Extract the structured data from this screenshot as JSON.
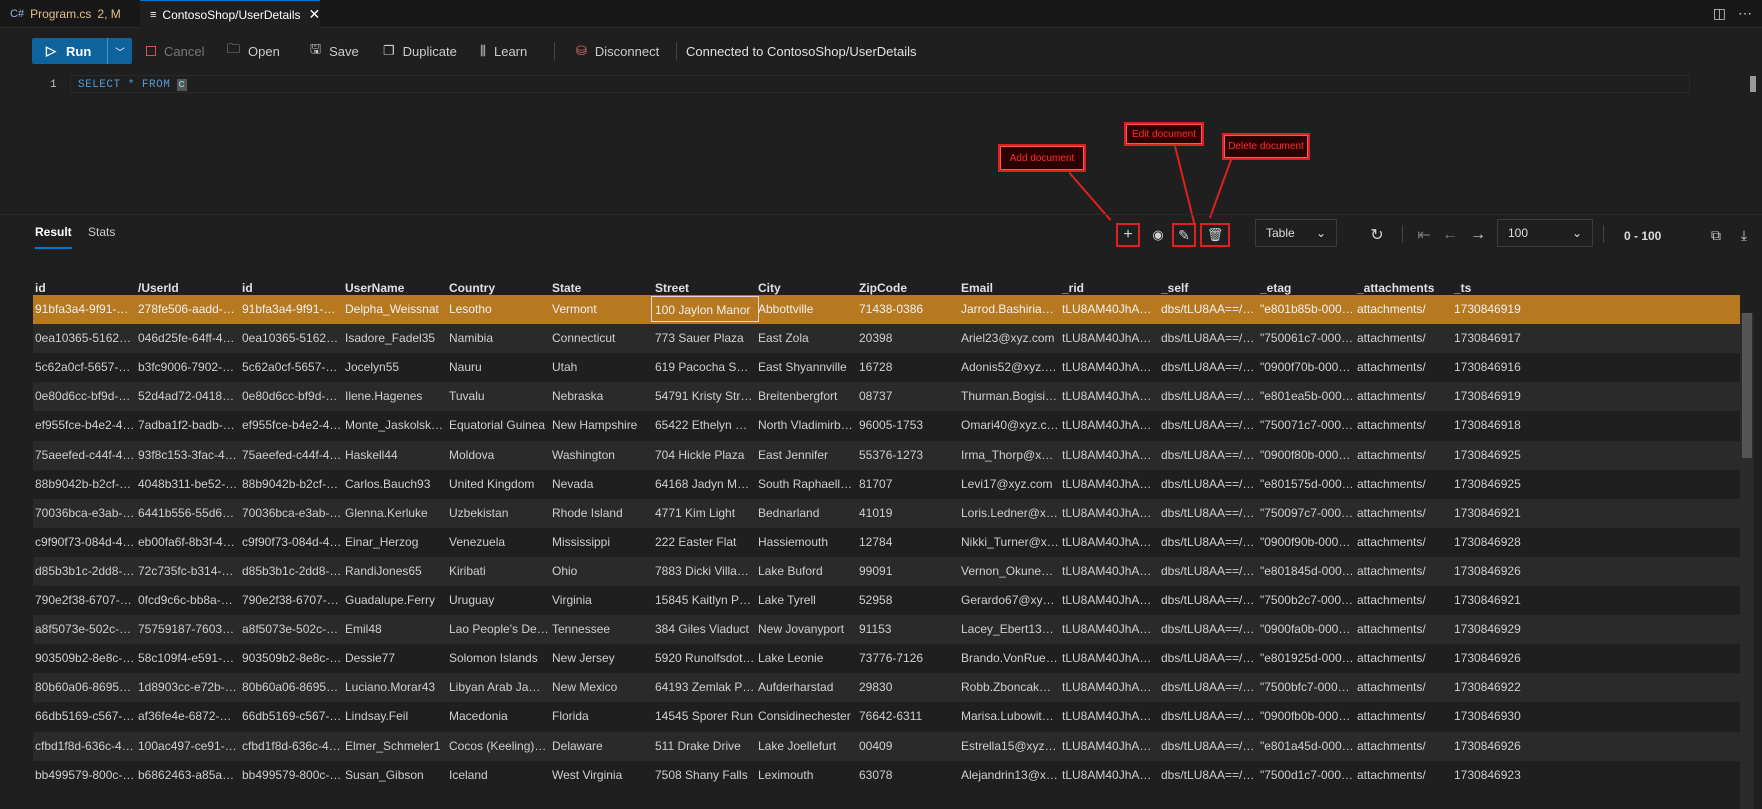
{
  "tabs": [
    {
      "icon": "csharp-icon",
      "label": "Program.cs",
      "badge": "2, M"
    },
    {
      "icon": "query-icon",
      "label": "ContosoShop/UserDetails",
      "close": "✕"
    }
  ],
  "toolbar": {
    "run": "Run",
    "cancel": "Cancel",
    "open": "Open",
    "save": "Save",
    "duplicate": "Duplicate",
    "learn": "Learn",
    "disconnect": "Disconnect",
    "status": "Connected to ContosoShop/UserDetails"
  },
  "editor": {
    "line_number": "1",
    "query_prefix": "SELECT * FROM ",
    "query_cursor": "c"
  },
  "annotations": {
    "add": "Add document",
    "edit": "Edit document",
    "delete": "Delete document"
  },
  "results": {
    "tab_result": "Result",
    "tab_stats": "Stats",
    "view_mode": "Table",
    "page_size": "100",
    "range": "0 - 100"
  },
  "colors": {
    "accent": "#0e639c",
    "selected_row": "#b7791f",
    "annotation": "#e02020"
  },
  "columns": [
    "id",
    "/UserId",
    "id",
    "UserName",
    "Country",
    "State",
    "Street",
    "City",
    "ZipCode",
    "Email",
    "_rid",
    "_self",
    "_etag",
    "_attachments",
    "_ts"
  ],
  "rows": [
    [
      "91bfa3a4-9f91-46...",
      "278fe506-aadd-45...",
      "91bfa3a4-9f91-46...",
      "Delpha_Weissnat",
      "Lesotho",
      "Vermont",
      "100 Jaylon Manor",
      "Abbottville",
      "71438-0386",
      "Jarrod.Bashirian91...",
      "tLU8AM40JhABA...",
      "dbs/tLU8AA==/c...",
      "\"e801b85b-0000-...",
      "attachments/",
      "1730846919"
    ],
    [
      "0ea10365-5162-43...",
      "046d25fe-64ff-48c...",
      "0ea10365-5162-43...",
      "Isadore_Fadel35",
      "Namibia",
      "Connecticut",
      "773 Sauer Plaza",
      "East Zola",
      "20398",
      "Ariel23@xyz.com",
      "tLU8AM40JhABA...",
      "dbs/tLU8AA==/c...",
      "\"750061c7-0000-...",
      "attachments/",
      "1730846917"
    ],
    [
      "5c62a0cf-5657-4b...",
      "b3fc9006-7902-4b...",
      "5c62a0cf-5657-4b...",
      "Jocelyn55",
      "Nauru",
      "Utah",
      "619 Pacocha Sprin...",
      "East Shyannville",
      "16728",
      "Adonis52@xyz.com",
      "tLU8AM40JhABA...",
      "dbs/tLU8AA==/c...",
      "\"0900f70b-0000-...",
      "attachments/",
      "1730846916"
    ],
    [
      "0e80d6cc-bf9d-49...",
      "52d4ad72-0418-4f...",
      "0e80d6cc-bf9d-49...",
      "Ilene.Hagenes",
      "Tuvalu",
      "Nebraska",
      "54791 Kristy Street",
      "Breitenbergfort",
      "08737",
      "Thurman.Bogisich...",
      "tLU8AM40JhACA...",
      "dbs/tLU8AA==/c...",
      "\"e801ea5b-0000-...",
      "attachments/",
      "1730846919"
    ],
    [
      "ef955fce-b4e2-44e...",
      "7adba1f2-badb-4c...",
      "ef955fce-b4e2-44e...",
      "Monte_Jaskolski19",
      "Equatorial Guinea",
      "New Hampshire",
      "65422 Ethelyn Stat...",
      "North Vladimirbur...",
      "96005-1753",
      "Omari40@xyz.com",
      "tLU8AM40JhACA...",
      "dbs/tLU8AA==/c...",
      "\"750071c7-0000-...",
      "attachments/",
      "1730846918"
    ],
    [
      "75aeefed-c44f-4d0...",
      "93f8c153-3fac-40e...",
      "75aeefed-c44f-4d0...",
      "Haskell44",
      "Moldova",
      "Washington",
      "704 Hickle Plaza",
      "East Jennifer",
      "55376-1273",
      "Irma_Thorp@xyz.c...",
      "tLU8AM40JhACA...",
      "dbs/tLU8AA==/c...",
      "\"0900f80b-0000-...",
      "attachments/",
      "1730846925"
    ],
    [
      "88b9042b-b2cf-42...",
      "4048b311-be52-4...",
      "88b9042b-b2cf-42...",
      "Carlos.Bauch93",
      "United Kingdom",
      "Nevada",
      "64168 Jadyn Moto...",
      "South Raphaellesh...",
      "81707",
      "Levi17@xyz.com",
      "tLU8AM40JhADA...",
      "dbs/tLU8AA==/c...",
      "\"e801575d-0000-...",
      "attachments/",
      "1730846925"
    ],
    [
      "70036bca-e3ab-4f...",
      "6441b556-55d6-4...",
      "70036bca-e3ab-4f...",
      "Glenna.Kerluke",
      "Uzbekistan",
      "Rhode Island",
      "4771 Kim Light",
      "Bednarland",
      "41019",
      "Loris.Ledner@xyz...",
      "tLU8AM40JhADA...",
      "dbs/tLU8AA==/c...",
      "\"750097c7-0000-...",
      "attachments/",
      "1730846921"
    ],
    [
      "c9f90f73-084d-47c...",
      "eb00fa6f-8b3f-4c9...",
      "c9f90f73-084d-47c...",
      "Einar_Herzog",
      "Venezuela",
      "Mississippi",
      "222 Easter Flat",
      "Hassiemouth",
      "12784",
      "Nikki_Turner@xyz...",
      "tLU8AM40JhADA...",
      "dbs/tLU8AA==/c...",
      "\"0900f90b-0000-...",
      "attachments/",
      "1730846928"
    ],
    [
      "d85b3b1c-2dd8-4...",
      "72c735fc-b314-44...",
      "d85b3b1c-2dd8-4...",
      "RandiJones65",
      "Kiribati",
      "Ohio",
      "7883 Dicki Villages",
      "Lake Buford",
      "99091",
      "Vernon_Okuneva...",
      "tLU8AM40JhAEA...",
      "dbs/tLU8AA==/c...",
      "\"e801845d-0000-...",
      "attachments/",
      "1730846926"
    ],
    [
      "790e2f38-6707-4c...",
      "0fcd9c6c-bb8a-43...",
      "790e2f38-6707-4c...",
      "Guadalupe.Ferry",
      "Uruguay",
      "Virginia",
      "15845 Kaitlyn Path",
      "Lake Tyrell",
      "52958",
      "Gerardo67@xyz.c...",
      "tLU8AM40JhAEA...",
      "dbs/tLU8AA==/c...",
      "\"7500b2c7-0000-...",
      "attachments/",
      "1730846921"
    ],
    [
      "a8f5073e-502c-46...",
      "75759187-7603-48...",
      "a8f5073e-502c-46...",
      "Emil48",
      "Lao People's Dem...",
      "Tennessee",
      "384 Giles Viaduct",
      "New Jovanyport",
      "91153",
      "Lacey_Ebert13@x...",
      "tLU8AM40JhAEA...",
      "dbs/tLU8AA==/c...",
      "\"0900fa0b-0000-...",
      "attachments/",
      "1730846929"
    ],
    [
      "903509b2-8e8c-49...",
      "58c109f4-e591-4d...",
      "903509b2-8e8c-49...",
      "Dessie77",
      "Solomon Islands",
      "New Jersey",
      "5920 Runolfsdottir...",
      "Lake Leonie",
      "73776-7126",
      "Brando.VonRuede...",
      "tLU8AM40JhAFAA...",
      "dbs/tLU8AA==/c...",
      "\"e801925d-0000-...",
      "attachments/",
      "1730846926"
    ],
    [
      "80b60a06-8695-48...",
      "1d8903cc-e72b-4c...",
      "80b60a06-8695-48...",
      "Luciano.Morar43",
      "Libyan Arab Jamah...",
      "New Mexico",
      "64193 Zemlak Plains",
      "Aufderharstad",
      "29830",
      "Robb.Zboncak@x...",
      "tLU8AM40JhAFAA...",
      "dbs/tLU8AA==/c...",
      "\"7500bfc7-0000-...",
      "attachments/",
      "1730846922"
    ],
    [
      "66db5169-c567-4...",
      "af36fe4e-6872-496...",
      "66db5169-c567-4...",
      "Lindsay.Feil",
      "Macedonia",
      "Florida",
      "14545 Sporer Run",
      "Considinechester",
      "76642-6311",
      "Marisa.Lubowitz@...",
      "tLU8AM40JhAFAA...",
      "dbs/tLU8AA==/c...",
      "\"0900fb0b-0000-...",
      "attachments/",
      "1730846930"
    ],
    [
      "cfbd1f8d-636c-41...",
      "100ac497-ce91-46...",
      "cfbd1f8d-636c-41...",
      "Elmer_Schmeler1",
      "Cocos (Keeling) Isl...",
      "Delaware",
      "511 Drake Drive",
      "Lake Joellefurt",
      "00409",
      "Estrella15@xyz.co...",
      "tLU8AM40JhAGA...",
      "dbs/tLU8AA==/c...",
      "\"e801a45d-0000-...",
      "attachments/",
      "1730846926"
    ],
    [
      "bb499579-800c-40...",
      "b6862463-a85a-4e...",
      "bb499579-800c-40...",
      "Susan_Gibson",
      "Iceland",
      "West Virginia",
      "7508 Shany Falls",
      "Leximouth",
      "63078",
      "Alejandrin13@xyz...",
      "tLU8AM40JhAGA...",
      "dbs/tLU8AA==/c...",
      "\"7500d1c7-0000-...",
      "attachments/",
      "1730846923"
    ]
  ]
}
